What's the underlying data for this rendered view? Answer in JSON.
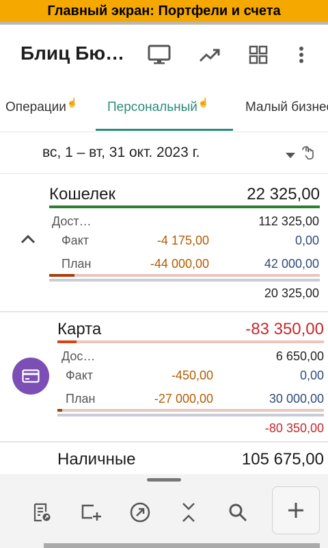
{
  "banner": "Главный экран: Портфели и счета",
  "appbar": {
    "title": "Блиц Бю…"
  },
  "tabs": [
    {
      "label": "Операции",
      "sup": "☝"
    },
    {
      "label": "Персональный",
      "sup": "☝"
    },
    {
      "label": "Малый бизнес"
    }
  ],
  "date_range": "вс, 1 – вт, 31 окт. 2023 г.",
  "accounts": [
    {
      "name": "Кошелек",
      "balance": "22 325,00",
      "available_label": "Дост…",
      "available": "112 325,00",
      "fact_label": "Факт",
      "fact_spent": "-4 175,00",
      "fact_income": "0,00",
      "plan_label": "План",
      "plan_spent": "-44 000,00",
      "plan_income": "42 000,00",
      "projected": "20 325,00",
      "colors": {
        "balance": "#1a1a1a",
        "underline": "#2e7d32"
      }
    },
    {
      "name": "Карта",
      "balance": "-83 350,00",
      "available_label": "Дос…",
      "available": "6 650,00",
      "fact_label": "Факт",
      "fact_spent": "-450,00",
      "fact_income": "0,00",
      "plan_label": "План",
      "plan_spent": "-27 000,00",
      "plan_income": "30 000,00",
      "projected": "-80 350,00",
      "colors": {
        "balance": "#c62828",
        "underline": "#d84315"
      }
    },
    {
      "name": "Наличные",
      "balance": "105 675,00"
    }
  ],
  "colors": {
    "accent": "#2a8a7c",
    "banner": "#f5a800",
    "spent": "#b35c00",
    "income": "#2d4a7a",
    "card_icon_bg": "#7b4fb5"
  }
}
